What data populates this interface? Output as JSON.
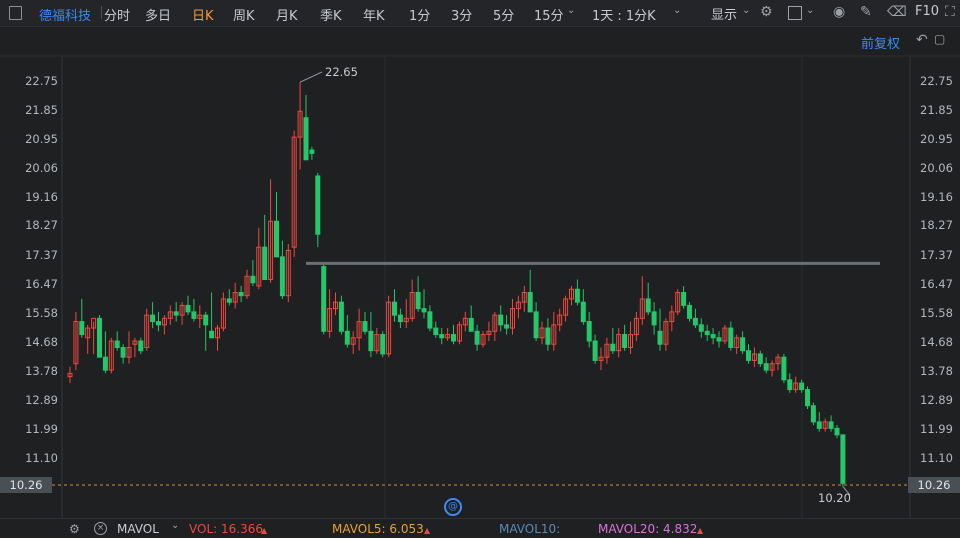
{
  "header": {
    "stock_name": "德福科技",
    "periods": [
      "分时",
      "多日",
      "日K",
      "周K",
      "月K",
      "季K",
      "年K",
      "1分",
      "3分",
      "5分",
      "15分",
      "1天 : 1分K"
    ],
    "active_period": "日K",
    "display_label": "显示",
    "f10_label": "F10"
  },
  "toolbar": {
    "adjust_label": "前复权"
  },
  "y_axis": {
    "ticks": [
      "22.75",
      "21.85",
      "20.95",
      "20.06",
      "19.16",
      "18.27",
      "17.37",
      "16.47",
      "15.58",
      "14.68",
      "13.78",
      "12.89",
      "11.99",
      "11.10"
    ],
    "current_price": "10.26"
  },
  "annotations": {
    "high_label": "22.65",
    "low_label": "10.20"
  },
  "volume_bar": {
    "indicator": "MAVOL",
    "vol": "VOL: 16.366",
    "mavol5": "MAVOL5: 6.053",
    "mavol10": "MAVOL10:",
    "mavol20": "MAVOL20: 4.832"
  },
  "colors": {
    "up": "#f0473e",
    "down": "#24c76a",
    "accent": "#3d8af7",
    "active": "#f59a2d"
  },
  "chart_data": {
    "type": "candlestick",
    "ylim": [
      10.0,
      23.2
    ],
    "candles": [
      [
        13.6,
        13.9,
        13.4,
        13.7
      ],
      [
        14.0,
        15.6,
        13.8,
        15.3
      ],
      [
        15.3,
        16.0,
        14.8,
        14.9
      ],
      [
        14.8,
        15.2,
        14.3,
        15.1
      ],
      [
        15.1,
        15.3,
        14.3,
        15.4
      ],
      [
        15.4,
        15.5,
        14.2,
        14.2
      ],
      [
        14.2,
        15.0,
        13.7,
        13.8
      ],
      [
        13.8,
        14.8,
        13.7,
        14.7
      ],
      [
        14.7,
        15.0,
        14.4,
        14.5
      ],
      [
        14.5,
        14.6,
        14.0,
        14.2
      ],
      [
        14.2,
        15.0,
        14.0,
        14.5
      ],
      [
        14.6,
        14.8,
        14.2,
        14.7
      ],
      [
        14.7,
        14.8,
        14.3,
        14.4
      ],
      [
        14.5,
        15.7,
        14.4,
        15.5
      ],
      [
        15.5,
        15.9,
        15.1,
        15.3
      ],
      [
        15.3,
        15.6,
        15.0,
        15.2
      ],
      [
        15.2,
        15.5,
        14.9,
        15.4
      ],
      [
        15.4,
        15.8,
        15.2,
        15.6
      ],
      [
        15.6,
        15.9,
        15.3,
        15.5
      ],
      [
        15.5,
        15.9,
        15.2,
        15.8
      ],
      [
        15.8,
        16.1,
        15.5,
        15.6
      ],
      [
        15.6,
        16.0,
        15.3,
        15.4
      ],
      [
        15.4,
        15.8,
        15.1,
        15.5
      ],
      [
        15.5,
        15.6,
        14.4,
        15.2
      ],
      [
        15.0,
        16.2,
        14.8,
        14.8
      ],
      [
        14.8,
        15.2,
        14.4,
        15.1
      ],
      [
        15.1,
        16.2,
        15.0,
        16.0
      ],
      [
        16.0,
        16.3,
        15.8,
        15.9
      ],
      [
        15.9,
        16.5,
        15.7,
        16.2
      ],
      [
        16.2,
        16.4,
        15.9,
        16.1
      ],
      [
        16.1,
        16.9,
        16.0,
        16.7
      ],
      [
        16.7,
        17.2,
        16.4,
        16.5
      ],
      [
        16.4,
        18.2,
        16.3,
        17.6
      ],
      [
        17.6,
        18.6,
        17.5,
        16.6
      ],
      [
        16.6,
        19.7,
        16.5,
        18.4
      ],
      [
        18.4,
        19.3,
        17.5,
        17.3
      ],
      [
        17.3,
        17.8,
        16.0,
        16.1
      ],
      [
        16.1,
        17.7,
        15.9,
        17.5
      ],
      [
        17.6,
        21.2,
        17.3,
        21.0
      ],
      [
        21.0,
        22.7,
        20.0,
        21.8
      ],
      [
        21.6,
        22.3,
        20.3,
        20.3
      ],
      [
        20.6,
        20.7,
        20.3,
        20.5
      ],
      [
        19.8,
        19.9,
        17.6,
        18.0
      ],
      [
        17.0,
        17.1,
        14.9,
        15.0
      ],
      [
        15.0,
        16.3,
        14.8,
        15.7
      ],
      [
        15.7,
        16.2,
        15.5,
        15.9
      ],
      [
        15.9,
        16.1,
        14.9,
        15.0
      ],
      [
        15.0,
        15.5,
        14.5,
        14.6
      ],
      [
        14.6,
        15.0,
        14.3,
        14.8
      ],
      [
        14.8,
        15.7,
        14.4,
        15.3
      ],
      [
        15.3,
        15.6,
        14.9,
        15.0
      ],
      [
        15.0,
        15.6,
        14.2,
        14.4
      ],
      [
        14.4,
        15.1,
        14.3,
        14.9
      ],
      [
        14.9,
        15.0,
        14.2,
        14.3
      ],
      [
        14.3,
        16.1,
        14.2,
        15.9
      ],
      [
        15.9,
        16.3,
        15.3,
        15.5
      ],
      [
        15.5,
        15.7,
        15.1,
        15.3
      ],
      [
        15.3,
        16.0,
        15.1,
        15.4
      ],
      [
        15.4,
        16.6,
        15.3,
        16.2
      ],
      [
        16.2,
        16.7,
        15.6,
        15.7
      ],
      [
        15.7,
        16.3,
        15.4,
        15.6
      ],
      [
        15.6,
        15.8,
        15.0,
        15.1
      ],
      [
        15.1,
        15.3,
        14.8,
        14.9
      ],
      [
        14.9,
        15.1,
        14.6,
        14.8
      ],
      [
        14.8,
        15.1,
        14.7,
        14.9
      ],
      [
        14.9,
        15.2,
        14.6,
        14.7
      ],
      [
        14.7,
        15.3,
        14.6,
        15.2
      ],
      [
        15.2,
        15.6,
        15.0,
        15.4
      ],
      [
        15.4,
        15.8,
        15.0,
        15.0
      ],
      [
        15.0,
        15.2,
        14.4,
        14.6
      ],
      [
        14.6,
        15.0,
        14.5,
        14.9
      ],
      [
        14.9,
        15.3,
        14.7,
        15.0
      ],
      [
        15.0,
        15.6,
        14.7,
        15.5
      ],
      [
        15.5,
        15.8,
        15.0,
        15.2
      ],
      [
        15.2,
        15.5,
        14.9,
        15.1
      ],
      [
        15.1,
        16.0,
        14.9,
        15.7
      ],
      [
        15.7,
        16.1,
        15.4,
        15.9
      ],
      [
        15.9,
        16.4,
        15.6,
        16.2
      ],
      [
        16.2,
        16.9,
        15.7,
        15.6
      ],
      [
        15.6,
        15.9,
        14.7,
        14.8
      ],
      [
        14.8,
        15.3,
        14.6,
        15.1
      ],
      [
        15.1,
        15.4,
        14.4,
        14.6
      ],
      [
        14.6,
        15.6,
        14.4,
        15.2
      ],
      [
        15.2,
        15.7,
        15.0,
        15.5
      ],
      [
        15.5,
        16.1,
        15.3,
        16.0
      ],
      [
        16.0,
        16.4,
        15.8,
        16.3
      ],
      [
        16.3,
        16.6,
        15.8,
        15.9
      ],
      [
        15.9,
        16.3,
        15.2,
        15.3
      ],
      [
        15.3,
        15.6,
        14.5,
        14.7
      ],
      [
        14.7,
        14.9,
        14.0,
        14.1
      ],
      [
        14.1,
        14.5,
        13.8,
        14.2
      ],
      [
        14.2,
        14.8,
        14.0,
        14.6
      ],
      [
        14.6,
        15.1,
        14.3,
        14.4
      ],
      [
        14.4,
        15.1,
        14.2,
        14.9
      ],
      [
        14.9,
        15.2,
        14.4,
        14.5
      ],
      [
        14.5,
        15.3,
        14.3,
        14.9
      ],
      [
        14.9,
        15.6,
        14.7,
        15.4
      ],
      [
        15.4,
        16.7,
        15.2,
        16.0
      ],
      [
        16.0,
        16.5,
        15.5,
        15.6
      ],
      [
        15.6,
        15.9,
        14.9,
        15.2
      ],
      [
        15.0,
        15.7,
        14.4,
        14.6
      ],
      [
        14.6,
        15.4,
        14.4,
        15.3
      ],
      [
        15.3,
        15.8,
        15.0,
        15.6
      ],
      [
        15.6,
        16.3,
        15.5,
        16.2
      ],
      [
        16.2,
        16.4,
        15.7,
        15.8
      ],
      [
        15.8,
        15.9,
        15.3,
        15.4
      ],
      [
        15.4,
        15.7,
        15.1,
        15.2
      ],
      [
        15.2,
        15.4,
        14.8,
        15.0
      ],
      [
        15.0,
        15.2,
        14.7,
        14.9
      ],
      [
        14.9,
        15.1,
        14.6,
        14.8
      ],
      [
        14.8,
        15.0,
        14.5,
        14.7
      ],
      [
        14.7,
        15.2,
        14.6,
        15.1
      ],
      [
        15.1,
        15.3,
        14.4,
        14.5
      ],
      [
        14.5,
        14.9,
        14.3,
        14.8
      ],
      [
        14.8,
        15.0,
        14.3,
        14.4
      ],
      [
        14.4,
        14.6,
        14.0,
        14.1
      ],
      [
        14.1,
        14.5,
        13.9,
        14.3
      ],
      [
        14.3,
        14.4,
        13.9,
        14.0
      ],
      [
        14.0,
        14.2,
        13.7,
        13.8
      ],
      [
        13.8,
        14.1,
        13.6,
        14.0
      ],
      [
        14.0,
        14.3,
        13.8,
        14.2
      ],
      [
        14.2,
        14.3,
        13.4,
        13.5
      ],
      [
        13.5,
        13.7,
        13.1,
        13.2
      ],
      [
        13.2,
        13.6,
        13.1,
        13.4
      ],
      [
        13.4,
        13.5,
        13.1,
        13.2
      ],
      [
        13.2,
        13.3,
        12.6,
        12.7
      ],
      [
        12.7,
        12.8,
        12.1,
        12.2
      ],
      [
        12.2,
        12.5,
        11.9,
        12.0
      ],
      [
        12.0,
        12.3,
        11.9,
        12.2
      ],
      [
        12.2,
        12.4,
        11.9,
        12.0
      ],
      [
        12.0,
        12.1,
        11.7,
        11.8
      ],
      [
        11.8,
        11.8,
        10.2,
        10.3
      ]
    ]
  }
}
